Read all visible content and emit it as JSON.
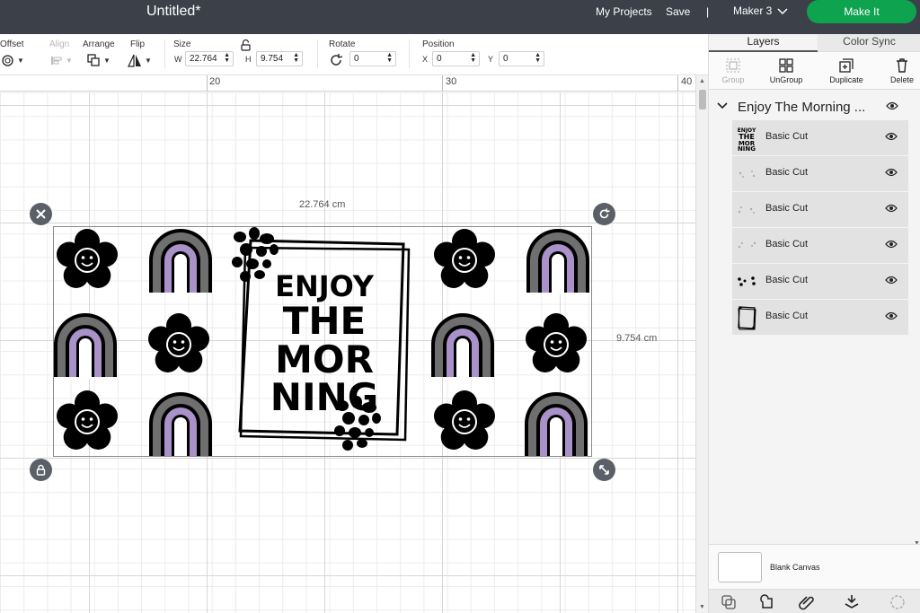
{
  "topbar": {
    "title": "Untitled*",
    "my_projects": "My Projects",
    "save": "Save",
    "separator": "|",
    "machine": "Maker 3",
    "make_it": "Make It",
    "make_it_color": "#0ea34f",
    "bar_color": "#3b4049"
  },
  "toolbar": {
    "offset_label": "Offset",
    "align_label": "Align",
    "arrange_label": "Arrange",
    "flip_label": "Flip",
    "size_label": "Size",
    "width_letter": "W",
    "width_value": "22.764",
    "height_letter": "H",
    "height_value": "9.754",
    "rotate_label": "Rotate",
    "rotate_value": "0",
    "position_label": "Position",
    "x_letter": "X",
    "x_value": "0",
    "y_letter": "Y",
    "y_value": "0"
  },
  "ruler": {
    "marks": [
      "20",
      "30",
      "40"
    ]
  },
  "canvas": {
    "width_dimension": "22.764 cm",
    "height_dimension": "9.754 cm",
    "design_text": [
      "ENJOY",
      "THE",
      "MOR",
      "NING"
    ],
    "purple": "#a991c9",
    "gray": "#6f6f6f"
  },
  "panel": {
    "tabs": [
      "Layers",
      "Color Sync"
    ],
    "actions": [
      "Group",
      "UnGroup",
      "Duplicate",
      "Delete"
    ],
    "group_title": "Enjoy The Morning ...",
    "layers": [
      "Basic Cut",
      "Basic Cut",
      "Basic Cut",
      "Basic Cut",
      "Basic Cut",
      "Basic Cut"
    ],
    "blank_canvas": "Blank Canvas"
  }
}
